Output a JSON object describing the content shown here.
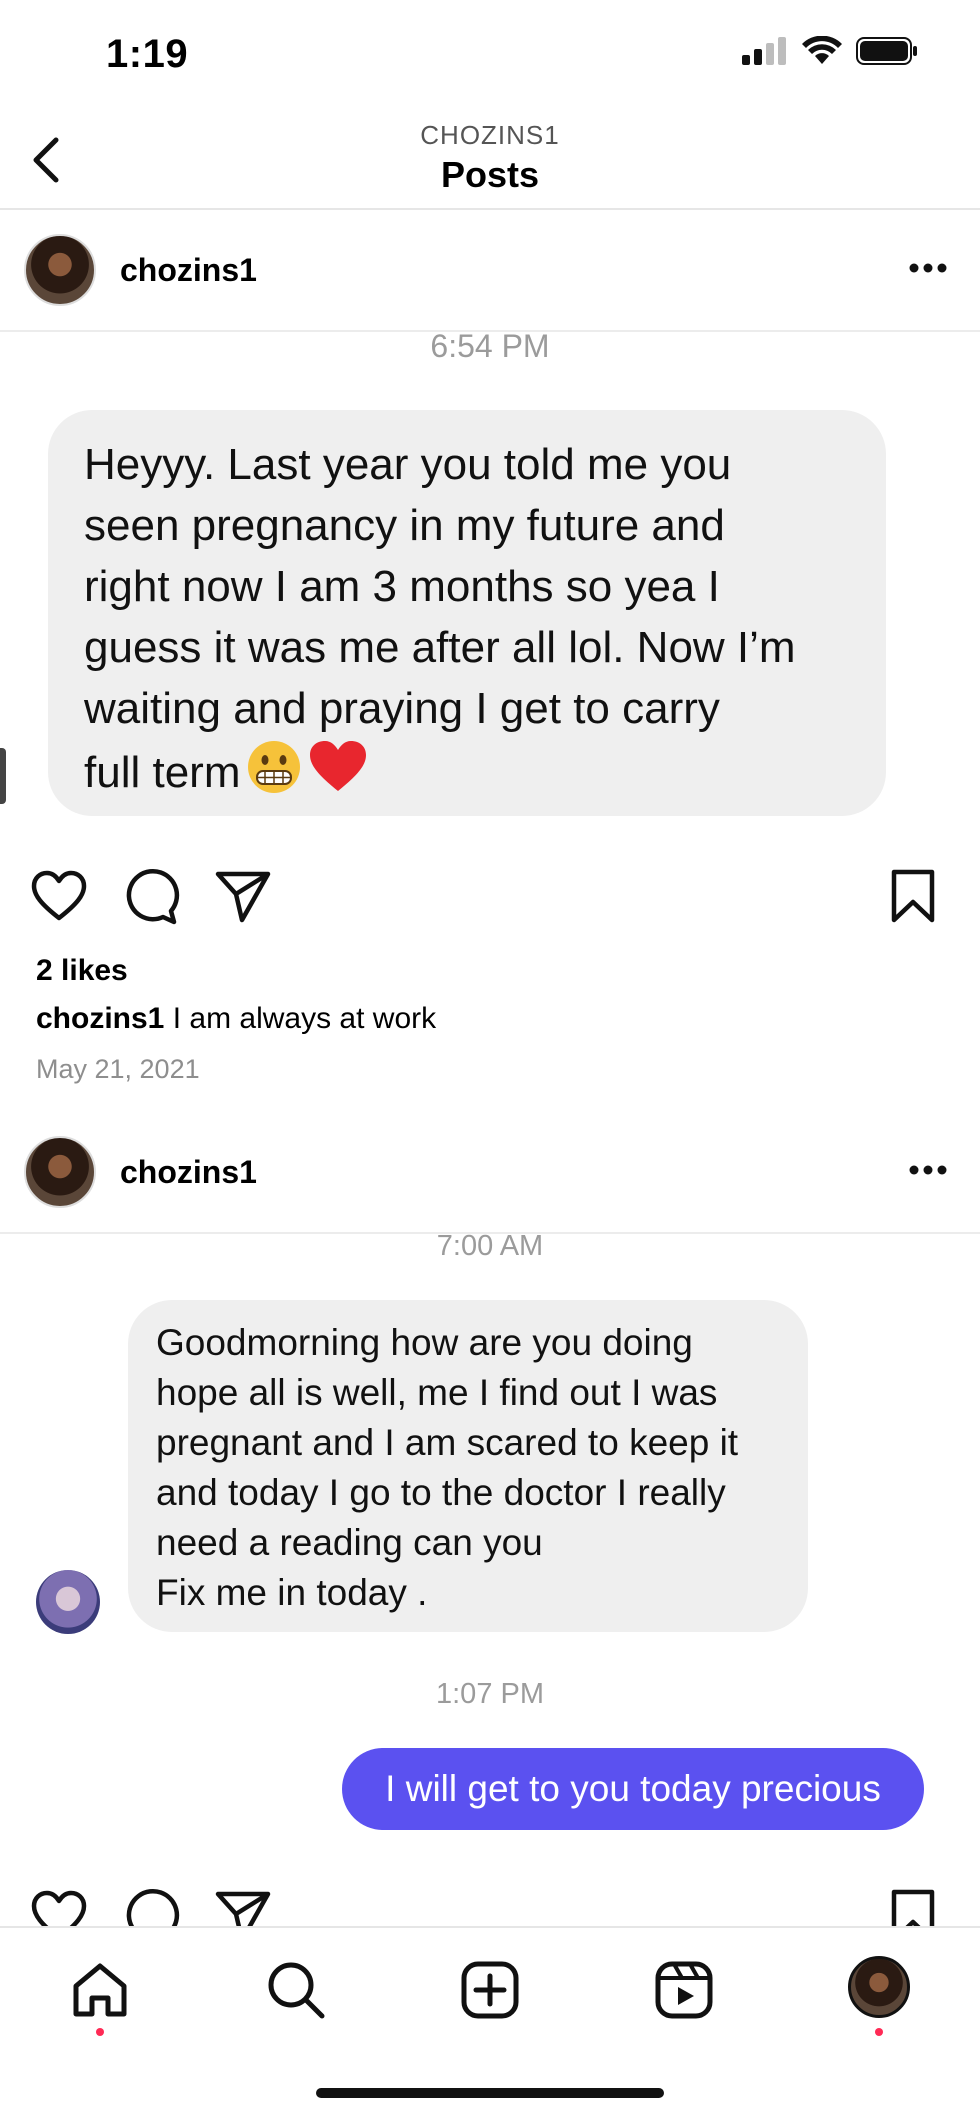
{
  "status_bar": {
    "time": "1:19"
  },
  "header": {
    "subtitle": "CHOZINS1",
    "title": "Posts"
  },
  "post1": {
    "username": "chozins1",
    "message_time": "6:54 PM",
    "message_lines": [
      "Heyyy. Last year you told me you",
      "seen pregnancy in my future and",
      "right now I am 3 months so yea I",
      "guess it was me after all lol. Now I’m",
      "waiting and praying I get to carry",
      "full term"
    ],
    "emojis": [
      "grimacing-face-emoji",
      "red-heart-emoji"
    ],
    "likes": "2 likes",
    "caption_user": "chozins1",
    "caption_text": "I am always at work",
    "date": "May 21, 2021"
  },
  "post2": {
    "username": "chozins1",
    "time_1": "7:00 AM",
    "received_lines": [
      "Goodmorning how are you doing",
      "hope all is well, me I find out I was",
      "pregnant and I am scared to keep it",
      "and today I go to the doctor I really",
      "need a reading can you",
      "Fix me in today ."
    ],
    "time_2": "1:07 PM",
    "sent_message": "I will get to you today precious"
  },
  "colors": {
    "sent_bubble": "#5b51f0",
    "received_bubble": "#efefef",
    "notification_dot": "#ff2a55"
  },
  "tabs": [
    "home-icon",
    "search-icon",
    "create-icon",
    "reels-icon",
    "profile-avatar"
  ]
}
